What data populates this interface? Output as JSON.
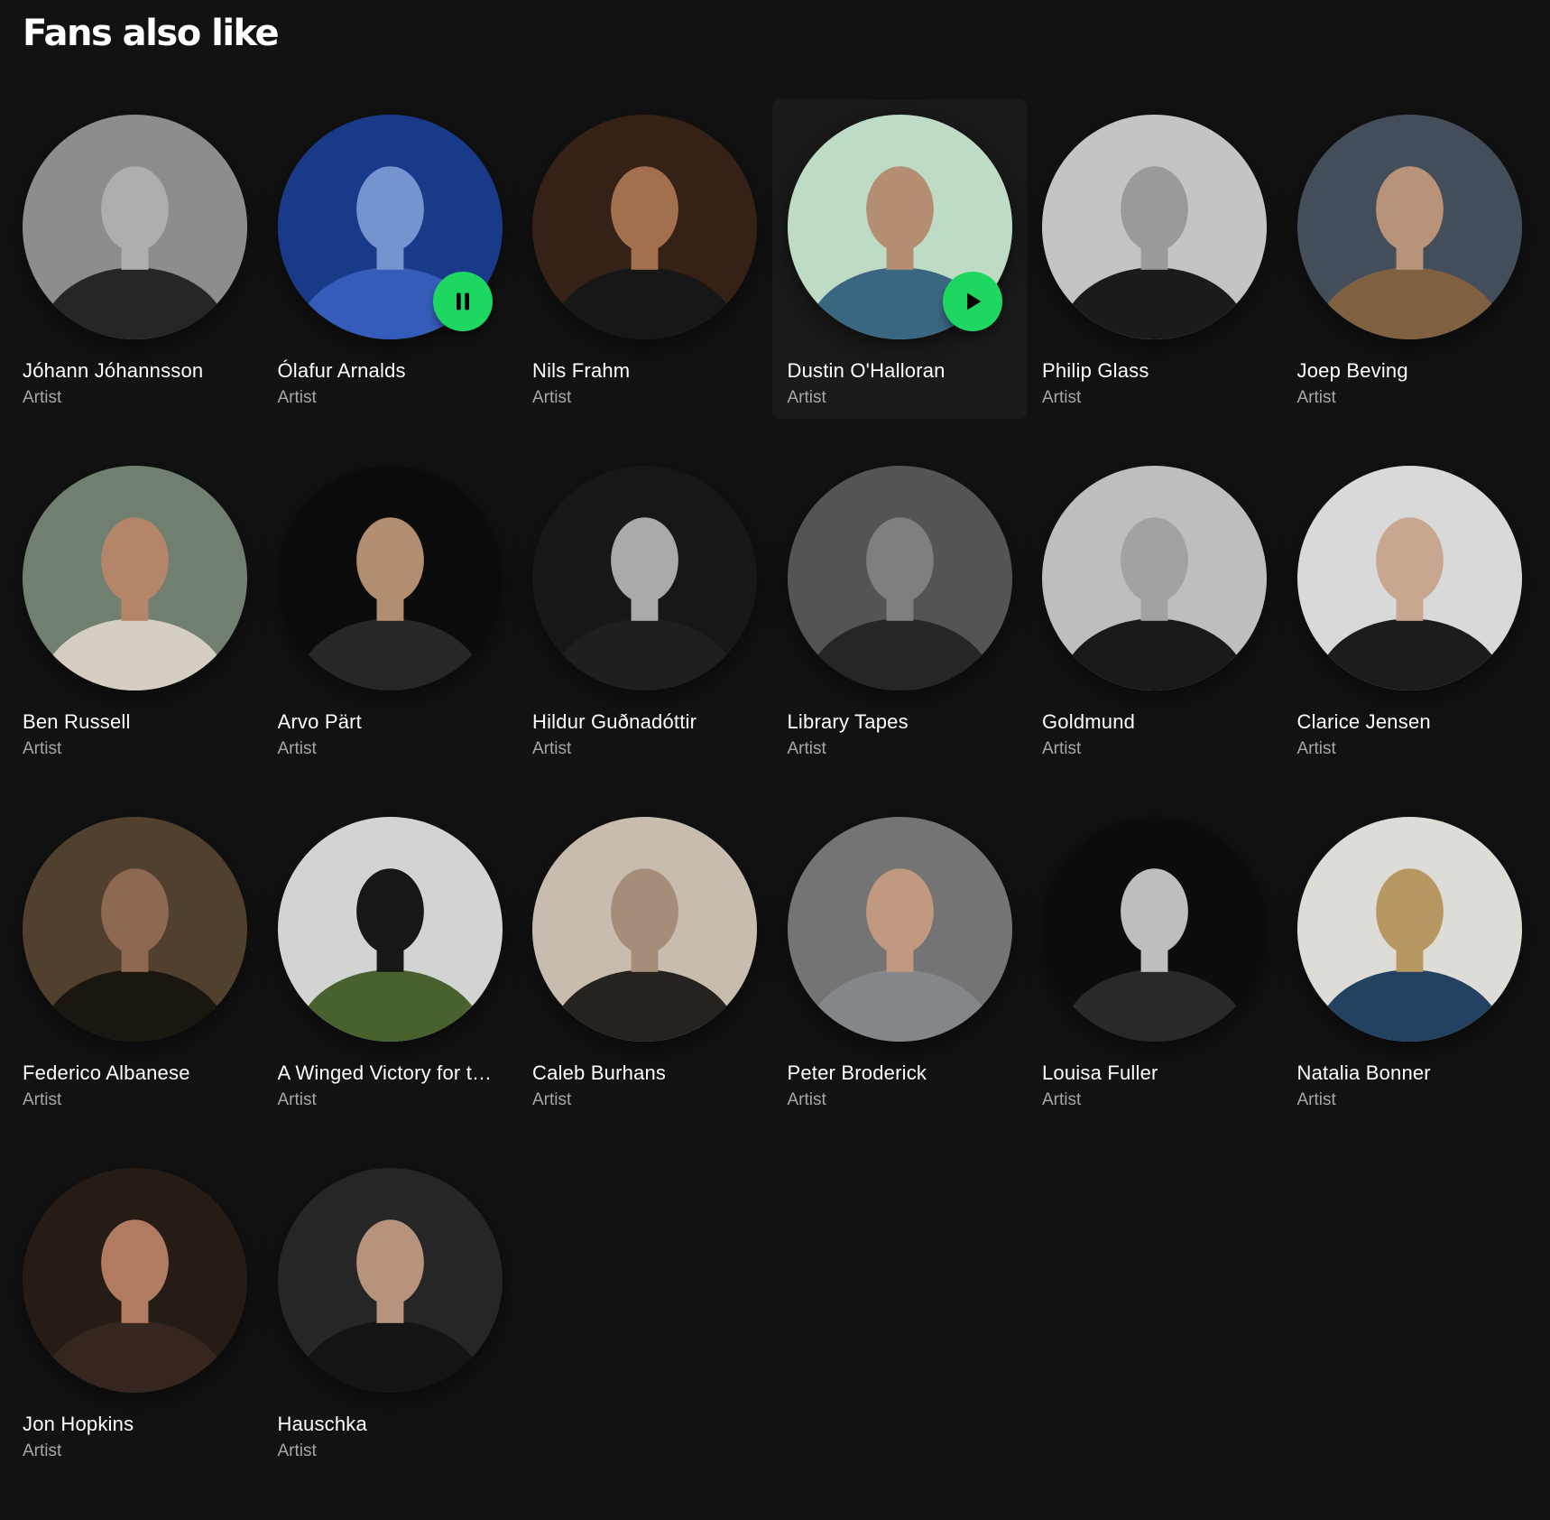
{
  "section": {
    "title": "Fans also like"
  },
  "artists": [
    {
      "name": "Jóhann Jóhannsson",
      "subtitle": "Artist",
      "bg": "#9a9a9a",
      "fg": "#2a2a2a",
      "skin": "#bdbdbd"
    },
    {
      "name": "Ólafur Arnalds",
      "subtitle": "Artist",
      "bg": "#1c3f94",
      "fg": "#3a64c8",
      "skin": "#7fa0e0",
      "control": "pause-icon"
    },
    {
      "name": "Nils Frahm",
      "subtitle": "Artist",
      "bg": "#3a2418",
      "fg": "#1a1a1a",
      "skin": "#b07a55"
    },
    {
      "name": "Dustin O'Halloran",
      "subtitle": "Artist",
      "bg": "#cfeed6",
      "fg": "#3f6f8c",
      "skin": "#c59a7c",
      "control": "play-icon",
      "hovered": true
    },
    {
      "name": "Philip Glass",
      "subtitle": "Artist",
      "bg": "#d5d5d5",
      "fg": "#1e1e1e",
      "skin": "#a8a8a8"
    },
    {
      "name": "Joep Beving",
      "subtitle": "Artist",
      "bg": "#4a5563",
      "fg": "#8a6a48",
      "skin": "#c8a084"
    },
    {
      "name": "Ben Russell",
      "subtitle": "Artist",
      "bg": "#7a8a7a",
      "fg": "#e8e1d4",
      "skin": "#c49272"
    },
    {
      "name": "Arvo Pärt",
      "subtitle": "Artist",
      "bg": "#0c0c0c",
      "fg": "#2b2b2b",
      "skin": "#c39a7a"
    },
    {
      "name": "Hildur Guðnadóttir",
      "subtitle": "Artist",
      "bg": "#1a1a1a",
      "fg": "#222222",
      "skin": "#b9b9b9"
    },
    {
      "name": "Library Tapes",
      "subtitle": "Artist",
      "bg": "#5c5c5c",
      "fg": "#2a2a2a",
      "skin": "#8a8a8a"
    },
    {
      "name": "Goldmund",
      "subtitle": "Artist",
      "bg": "#cfcfcf",
      "fg": "#1c1c1c",
      "skin": "#b0b0b0"
    },
    {
      "name": "Clarice Jensen",
      "subtitle": "Artist",
      "bg": "#ececec",
      "fg": "#1f1f1f",
      "skin": "#d9b59c"
    },
    {
      "name": "Federico Albanese",
      "subtitle": "Artist",
      "bg": "#5a4632",
      "fg": "#1e1812",
      "skin": "#9a7258"
    },
    {
      "name": "A Winged Victory for the Sullen",
      "subtitle": "Artist",
      "bg": "#e4e6e4",
      "fg": "#4f6a34",
      "skin": "#1a1a1a"
    },
    {
      "name": "Caleb Burhans",
      "subtitle": "Artist",
      "bg": "#d8ccbc",
      "fg": "#2a2622",
      "skin": "#b49a84"
    },
    {
      "name": "Peter Broderick",
      "subtitle": "Artist",
      "bg": "#7e7e7e",
      "fg": "#8f9296",
      "skin": "#d2a68c"
    },
    {
      "name": "Louisa Fuller",
      "subtitle": "Artist",
      "bg": "#0e0e0e",
      "fg": "#2d2d2d",
      "skin": "#cfcfcf"
    },
    {
      "name": "Natalia Bonner",
      "subtitle": "Artist",
      "bg": "#f1efe9",
      "fg": "#27486a",
      "skin": "#c7a46a"
    },
    {
      "name": "Jon Hopkins",
      "subtitle": "Artist",
      "bg": "#2a1f18",
      "fg": "#3a2a22",
      "skin": "#c0866a"
    },
    {
      "name": "Hauschka",
      "subtitle": "Artist",
      "bg": "#2a2a2a",
      "fg": "#161616",
      "skin": "#c7a088"
    }
  ]
}
